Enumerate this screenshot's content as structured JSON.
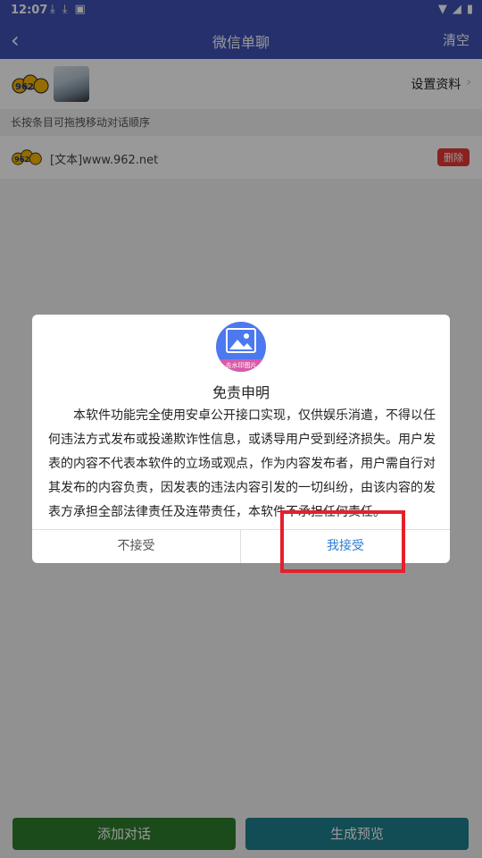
{
  "status_bar": {
    "time": "12:07",
    "icons_left": [
      "download-icon",
      "download-icon",
      "a-icon"
    ],
    "icons_right": [
      "wifi-icon",
      "signal-icon",
      "battery-icon"
    ]
  },
  "title_bar": {
    "title": "微信单聊",
    "clear_label": "清空"
  },
  "profile": {
    "logo_text": "962",
    "settings_label": "设置资料"
  },
  "hint": "长按条目可拖拽移动对话顺序",
  "messages": [
    {
      "text": "[文本]www.962.net",
      "delete_label": "删除"
    }
  ],
  "dialog": {
    "icon_caption": "去水印图片",
    "title": "免责申明",
    "body": "本软件功能完全使用安卓公开接口实现，仅供娱乐消遣，不得以任何违法方式发布或投递欺诈性信息，或诱导用户受到经济损失。用户发表的内容不代表本软件的立场或观点，作为内容发布者，用户需自行对其发布的内容负责，因发表的违法内容引发的一切纠纷，由该内容的发表方承担全部法律责任及连带责任，本软件不承担任何责任。",
    "reject_label": "不接受",
    "accept_label": "我接受"
  },
  "bottom": {
    "add_label": "添加对话",
    "preview_label": "生成预览"
  },
  "colors": {
    "primary": "#3f51b5",
    "accent_blue": "#2b7cd3",
    "highlight": "#e5202b",
    "add_green": "#2e7d2e",
    "preview_teal": "#1f7f8c"
  }
}
